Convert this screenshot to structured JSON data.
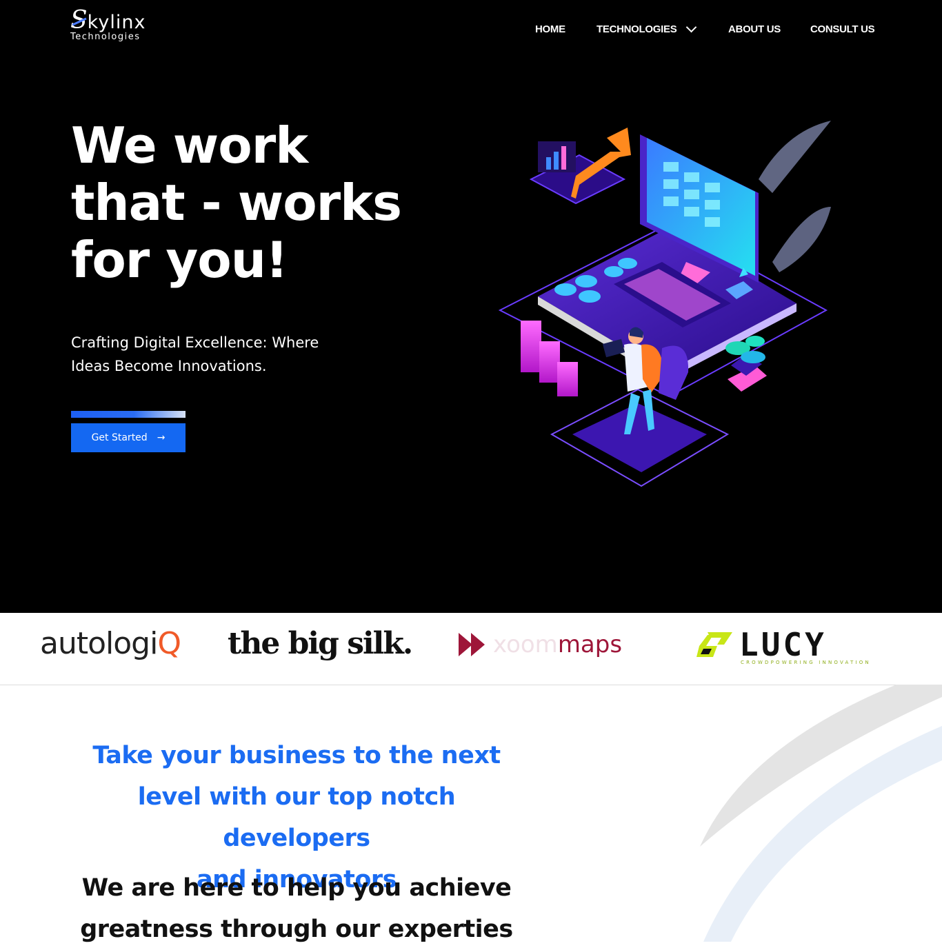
{
  "brand": {
    "logo_mark": "kylinx",
    "logo_sub": "Technologies"
  },
  "nav": {
    "home": "HOME",
    "technologies": "TECHNOLOGIES",
    "about": "ABOUT US",
    "consult": "CONSULT US"
  },
  "hero": {
    "headline_1": "We work",
    "headline_2": "that - works",
    "headline_3": "for you!",
    "subtitle_1": "Crafting Digital Excellence: Where",
    "subtitle_2": "Ideas Become Innovations.",
    "cta_label": "Get Started",
    "cta_arrow": "→"
  },
  "clients": {
    "autologiq_main": "autologi",
    "autologiq_q": "Q",
    "bigsilk": "the big silk.",
    "zoom_a": "xoom",
    "zoom_b": "maps",
    "lucy": "LUCY",
    "lucy_tag": "CROWDPOWERING INNOVATION"
  },
  "section": {
    "title_1": "Take your business to the next",
    "title_2": "level with our top notch developers",
    "title_3": "and innovators",
    "sub_1": "We are here to help you achieve",
    "sub_2": "greatness through our experties"
  },
  "colors": {
    "accent": "#1b6cf2",
    "hero_bg": "#000000",
    "button": "#1468f2"
  }
}
